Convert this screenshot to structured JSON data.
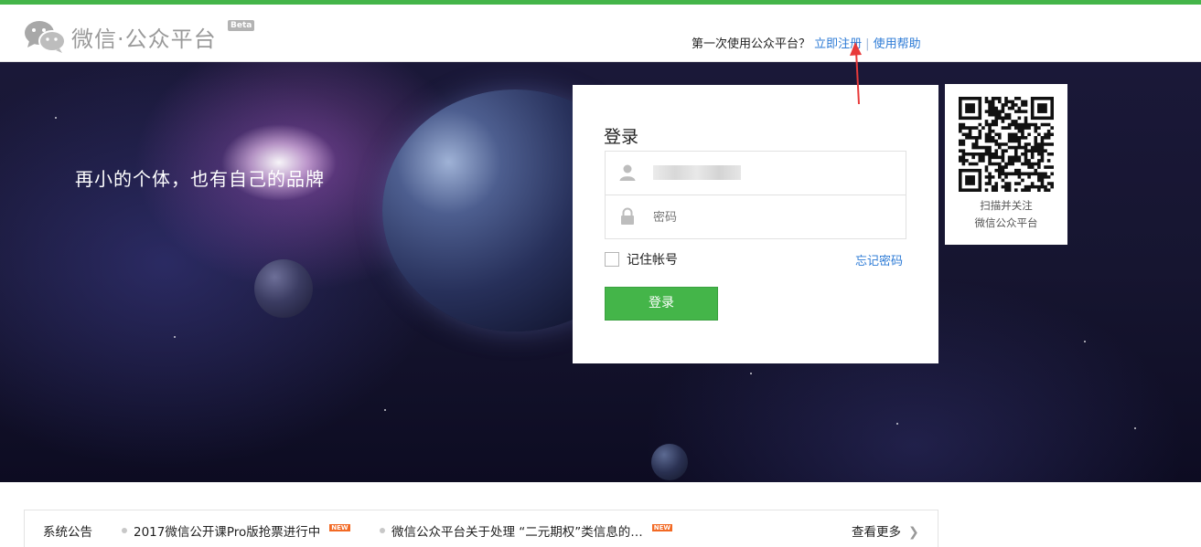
{
  "header": {
    "logo_text": "微信·公众平台",
    "beta_label": "Beta",
    "prompt_text": "第一次使用公众平台？",
    "register_link": "立即注册",
    "separator": "|",
    "help_link": "使用帮助"
  },
  "banner": {
    "tagline": "再小的个体，也有自己的品牌"
  },
  "login": {
    "title": "登录",
    "username_value": "",
    "password_placeholder": "密码",
    "remember_label": "记住帐号",
    "forgot_link": "忘记密码",
    "submit_label": "登录"
  },
  "qr": {
    "line1": "扫描并关注",
    "line2": "微信公众平台"
  },
  "notice": {
    "title": "系统公告",
    "items": [
      {
        "text": "2017微信公开课Pro版抢票进行中",
        "badge": "NEW"
      },
      {
        "text": "微信公众平台关于处理 “二元期权”类信息的…",
        "badge": "NEW"
      }
    ],
    "more_label": "查看更多"
  },
  "colors": {
    "brand_green": "#44b549",
    "link_blue": "#2d7bd6",
    "new_badge": "#f26a25"
  },
  "icons": [
    "wechat-logo-icon",
    "user-icon",
    "lock-icon",
    "qr-code-icon",
    "chevron-right-icon",
    "red-arrow-annotation"
  ]
}
